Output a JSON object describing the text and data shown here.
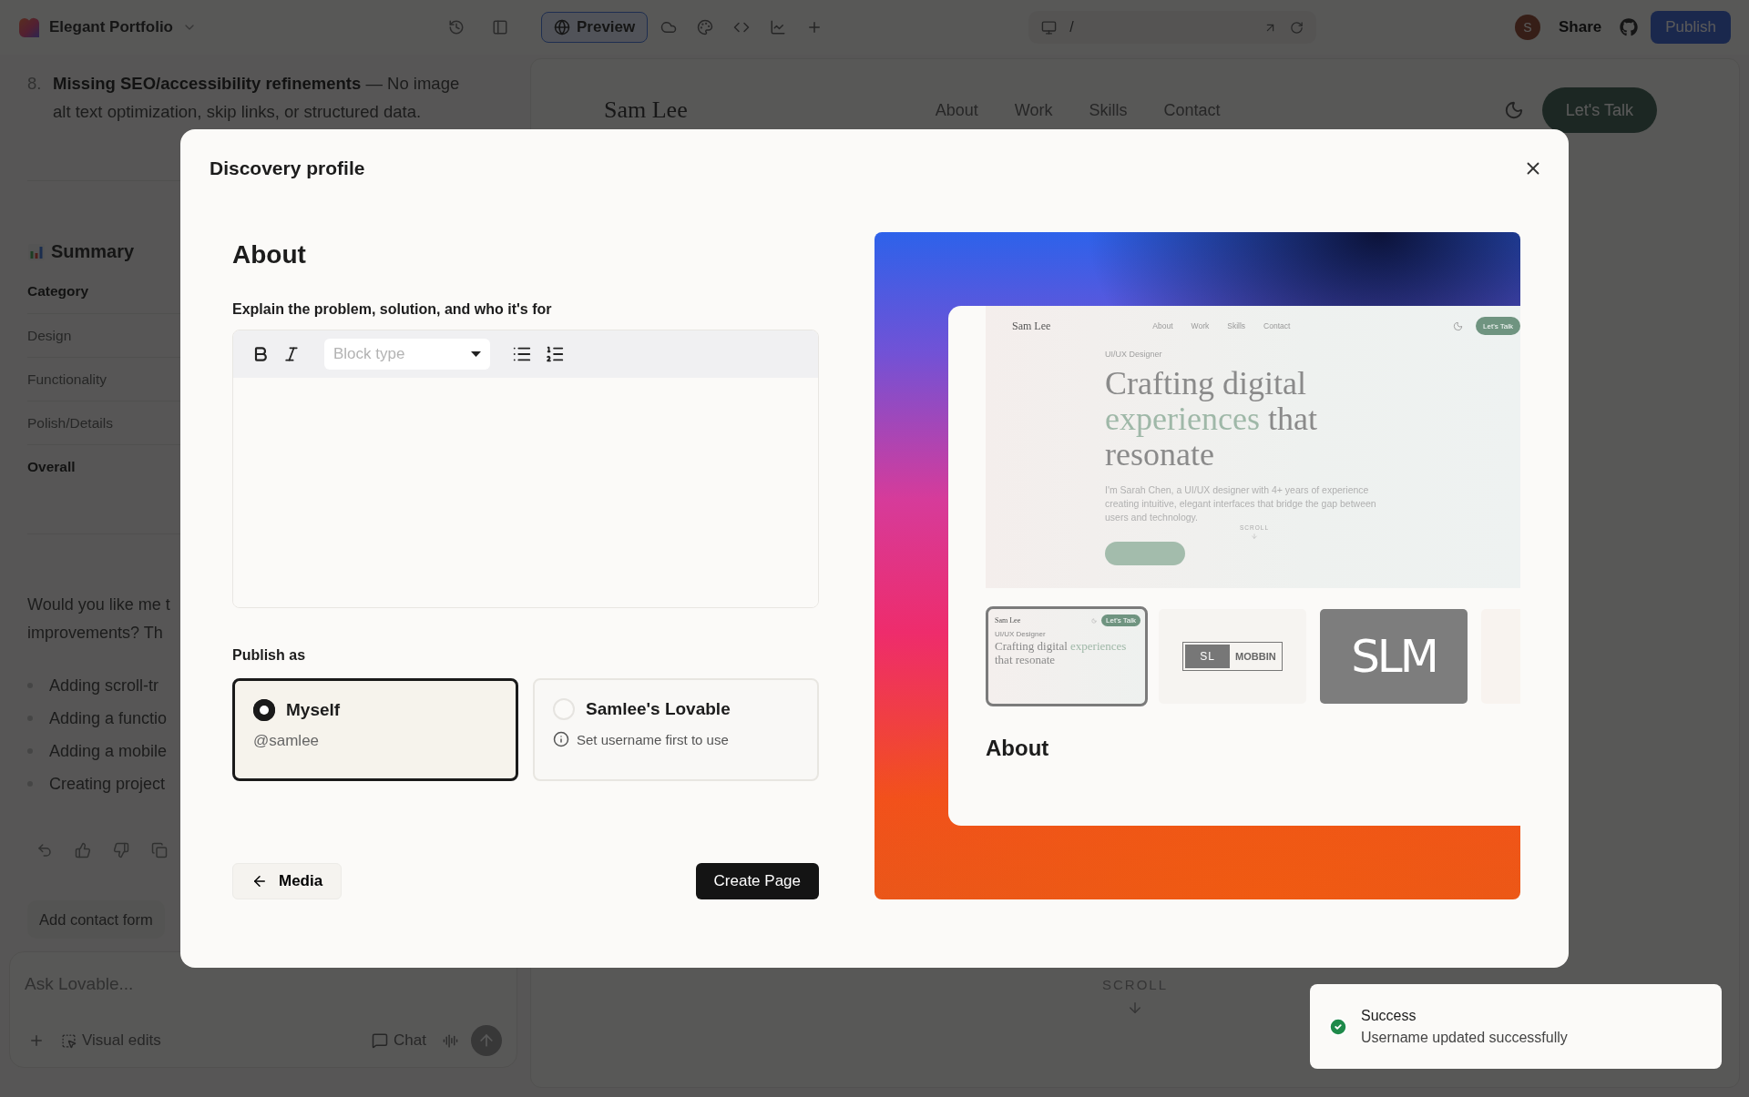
{
  "top_bar": {
    "project": "Elegant Portfolio",
    "tools": [
      {
        "kind": "preview",
        "label": "Preview",
        "selected": true
      },
      {
        "kind": "cloud",
        "selected": false
      },
      {
        "kind": "palette",
        "selected": false
      },
      {
        "kind": "code",
        "selected": false
      },
      {
        "kind": "chart",
        "selected": false
      },
      {
        "kind": "plus",
        "selected": false
      }
    ],
    "path": "/",
    "avatar": "S",
    "share": "Share",
    "publish": "Publish"
  },
  "chat": {
    "list_number": "8.",
    "list_text": "**Missing SEO/accessibility refinements** — No image alt text optimization, skip links, or structured data.",
    "summary_title": "Summary",
    "summary_rows": [
      {
        "label": "Category",
        "kind": "header"
      },
      {
        "label": "Design",
        "kind": "row"
      },
      {
        "label": "Functionality",
        "kind": "row"
      },
      {
        "label": "Polish/Details",
        "kind": "row"
      },
      {
        "label": "Overall",
        "kind": "total"
      }
    ],
    "question_lines": [
      "Would you like me t",
      "improvements? Th"
    ],
    "bullets": [
      "Adding scroll-tr",
      "Adding a functio",
      "Adding a mobile",
      "Creating project"
    ],
    "suggestion": "Add contact form",
    "composer": {
      "placeholder": "Ask Lovable...",
      "visual_edits": "Visual edits",
      "chat": "Chat"
    }
  },
  "site_preview": {
    "logo": "Sam Lee",
    "nav": [
      "About",
      "Work",
      "Skills",
      "Contact"
    ],
    "cta": "Let's Talk",
    "scroll": "SCROLL"
  },
  "dialog": {
    "title": "Discovery profile",
    "section_title": "About",
    "field_label": "Explain the problem, solution, and who it's for",
    "block_type": "Block type",
    "publish_label": "Publish as",
    "options": [
      {
        "name": "Myself",
        "handle": "@samlee",
        "selected": true
      },
      {
        "name": "Samlee's Lovable",
        "note": "Set username first to use",
        "selected": false
      }
    ],
    "back_button": "Media",
    "primary_button": "Create Page",
    "preview": {
      "site": {
        "logo": "Sam Lee",
        "nav": [
          "About",
          "Work",
          "Skills",
          "Contact"
        ],
        "cta": "Let's Talk",
        "eyebrow": "UI/UX Designer",
        "headline": [
          {
            "text": "Crafting digital ",
            "accent": false
          },
          {
            "text": "experiences",
            "accent": true
          },
          {
            "text": " that resonate",
            "accent": false
          }
        ],
        "intro": "I'm Sarah Chen, a UI/UX designer with 4+ years of experience creating intuitive, elegant interfaces that bridge the gap between users and technology.",
        "scroll": "SCROLL"
      },
      "thumbnails": [
        {
          "kind": "site",
          "selected": true,
          "logo": "Sam Lee",
          "cta": "Let's Talk",
          "eyebrow": "UI/UX Designer",
          "headline": [
            {
              "text": "Crafting digital ",
              "accent": false
            },
            {
              "text": "experiences",
              "accent": true
            },
            {
              "text": " that resonate",
              "accent": false
            }
          ]
        },
        {
          "kind": "wordmark",
          "selected": false,
          "left": "SL",
          "right": "MOBBIN"
        },
        {
          "kind": "monogram",
          "selected": false,
          "text": "SLM"
        },
        {
          "kind": "blank",
          "selected": false
        }
      ],
      "caption": "About"
    }
  },
  "toast": {
    "title": "Success",
    "message": "Username updated successfully"
  }
}
